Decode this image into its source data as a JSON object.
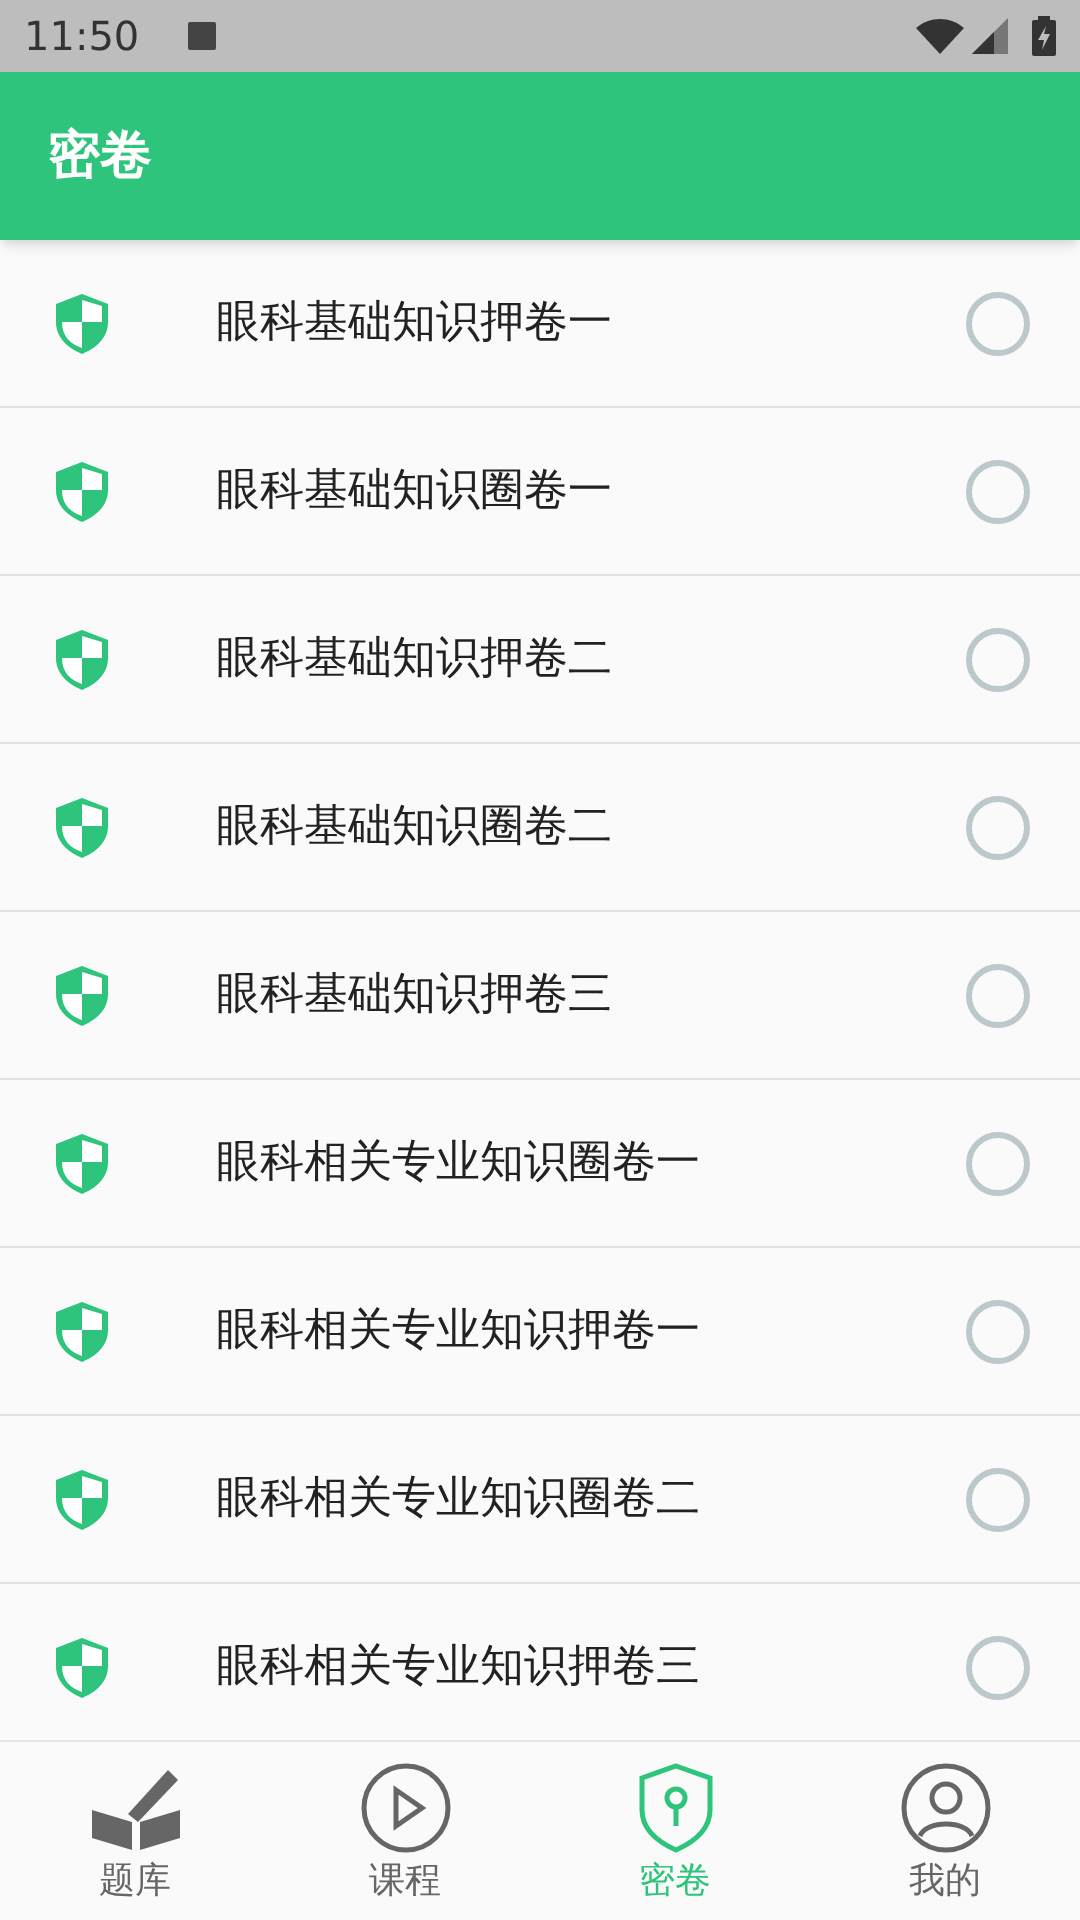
{
  "status_bar": {
    "time": "11:50"
  },
  "header": {
    "title": "密卷"
  },
  "papers": [
    {
      "title": "眼科基础知识押卷一",
      "selected": false
    },
    {
      "title": "眼科基础知识圈卷一",
      "selected": false
    },
    {
      "title": "眼科基础知识押卷二",
      "selected": false
    },
    {
      "title": "眼科基础知识圈卷二",
      "selected": false
    },
    {
      "title": "眼科基础知识押卷三",
      "selected": false
    },
    {
      "title": "眼科相关专业知识圈卷一",
      "selected": false
    },
    {
      "title": "眼科相关专业知识押卷一",
      "selected": false
    },
    {
      "title": "眼科相关专业知识圈卷二",
      "selected": false
    },
    {
      "title": "眼科相关专业知识押卷三",
      "selected": false
    }
  ],
  "bottom_nav": [
    {
      "kind": "bank",
      "label": "题库",
      "selected": false
    },
    {
      "kind": "course",
      "label": "课程",
      "selected": false
    },
    {
      "kind": "secret",
      "label": "密卷",
      "selected": true
    },
    {
      "kind": "profile",
      "label": "我的",
      "selected": false
    }
  ]
}
